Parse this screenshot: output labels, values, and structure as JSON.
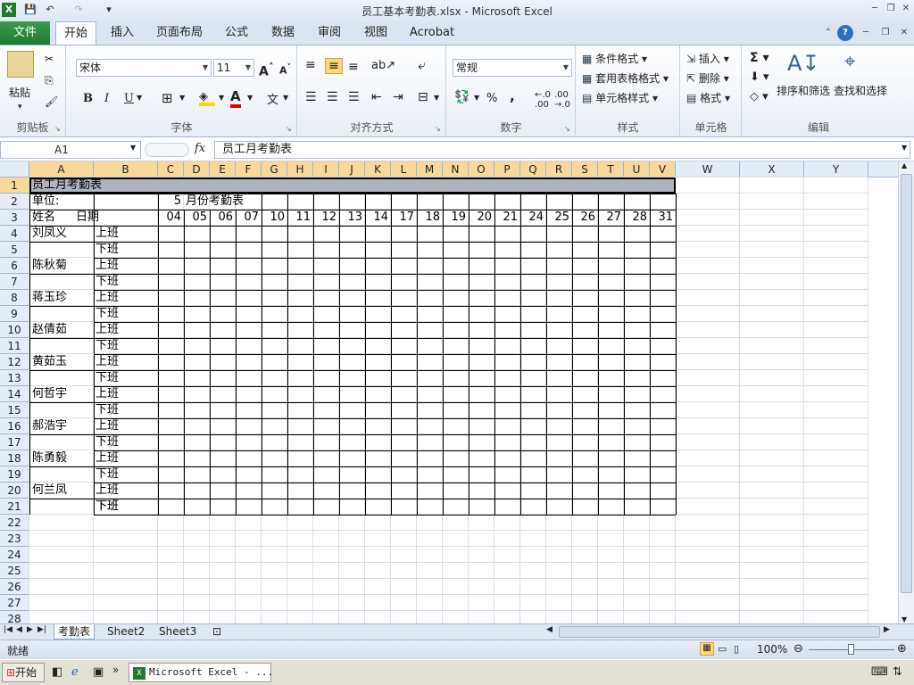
{
  "window": {
    "title": "员工基本考勤表.xlsx - Microsoft Excel"
  },
  "ribbon_tabs": {
    "file": "文件",
    "home": "开始",
    "insert": "插入",
    "page_layout": "页面布局",
    "formulas": "公式",
    "data": "数据",
    "review": "审阅",
    "view": "视图",
    "acrobat": "Acrobat"
  },
  "ribbon": {
    "clipboard": {
      "label": "剪贴板",
      "paste": "粘贴"
    },
    "font": {
      "label": "字体",
      "font_name": "宋体",
      "font_size": "11",
      "bold": "B",
      "italic": "I",
      "underline": "U"
    },
    "alignment": {
      "label": "对齐方式"
    },
    "number": {
      "label": "数字",
      "format": "常规",
      "percent": "%",
      "comma": ","
    },
    "styles": {
      "label": "样式",
      "conditional": "条件格式",
      "table": "套用表格格式",
      "cell_styles": "单元格样式"
    },
    "cells": {
      "label": "单元格",
      "insert": "插入",
      "delete": "删除",
      "format": "格式"
    },
    "editing": {
      "label": "编辑",
      "sort_filter": "排序和筛选",
      "find_select": "查找和选择",
      "sum": "Σ"
    }
  },
  "formula_bar": {
    "name_box": "A1",
    "fx": "fx",
    "content": "员工月考勤表"
  },
  "columns": [
    "A",
    "B",
    "C",
    "D",
    "E",
    "F",
    "G",
    "H",
    "I",
    "J",
    "K",
    "L",
    "M",
    "N",
    "O",
    "P",
    "Q",
    "R",
    "S",
    "T",
    "U",
    "V",
    "W",
    "X",
    "Y"
  ],
  "rows": [
    "1",
    "2",
    "3",
    "4",
    "5",
    "6",
    "7",
    "8",
    "9",
    "10",
    "11",
    "12",
    "13",
    "14",
    "15",
    "16",
    "17",
    "18",
    "19",
    "20",
    "21",
    "22",
    "23",
    "24",
    "25",
    "26",
    "27",
    "28"
  ],
  "cells": {
    "title": "员工月考勤表",
    "unit_label": "单位:",
    "month_num": "5",
    "month_title": "月份考勤表",
    "name_header": "姓名",
    "date_header": "日期",
    "dates": [
      "04",
      "05",
      "06",
      "07",
      "10",
      "11",
      "12",
      "13",
      "14",
      "17",
      "18",
      "19",
      "20",
      "21",
      "24",
      "25",
      "26",
      "27",
      "28",
      "31"
    ],
    "employees": [
      "刘凤义",
      "陈秋菊",
      "蒋玉珍",
      "赵倩茹",
      "黄茹玉",
      "何哲宇",
      "郝浩宇",
      "陈勇毅",
      "何兰凤"
    ],
    "on_duty": "上班",
    "off_duty": "下班"
  },
  "sheet_tabs": [
    "考勤表",
    "Sheet2",
    "Sheet3"
  ],
  "status": {
    "ready": "就绪",
    "zoom": "100%"
  },
  "taskbar": {
    "start": "开始",
    "app_button": "Microsoft Excel - ..."
  }
}
